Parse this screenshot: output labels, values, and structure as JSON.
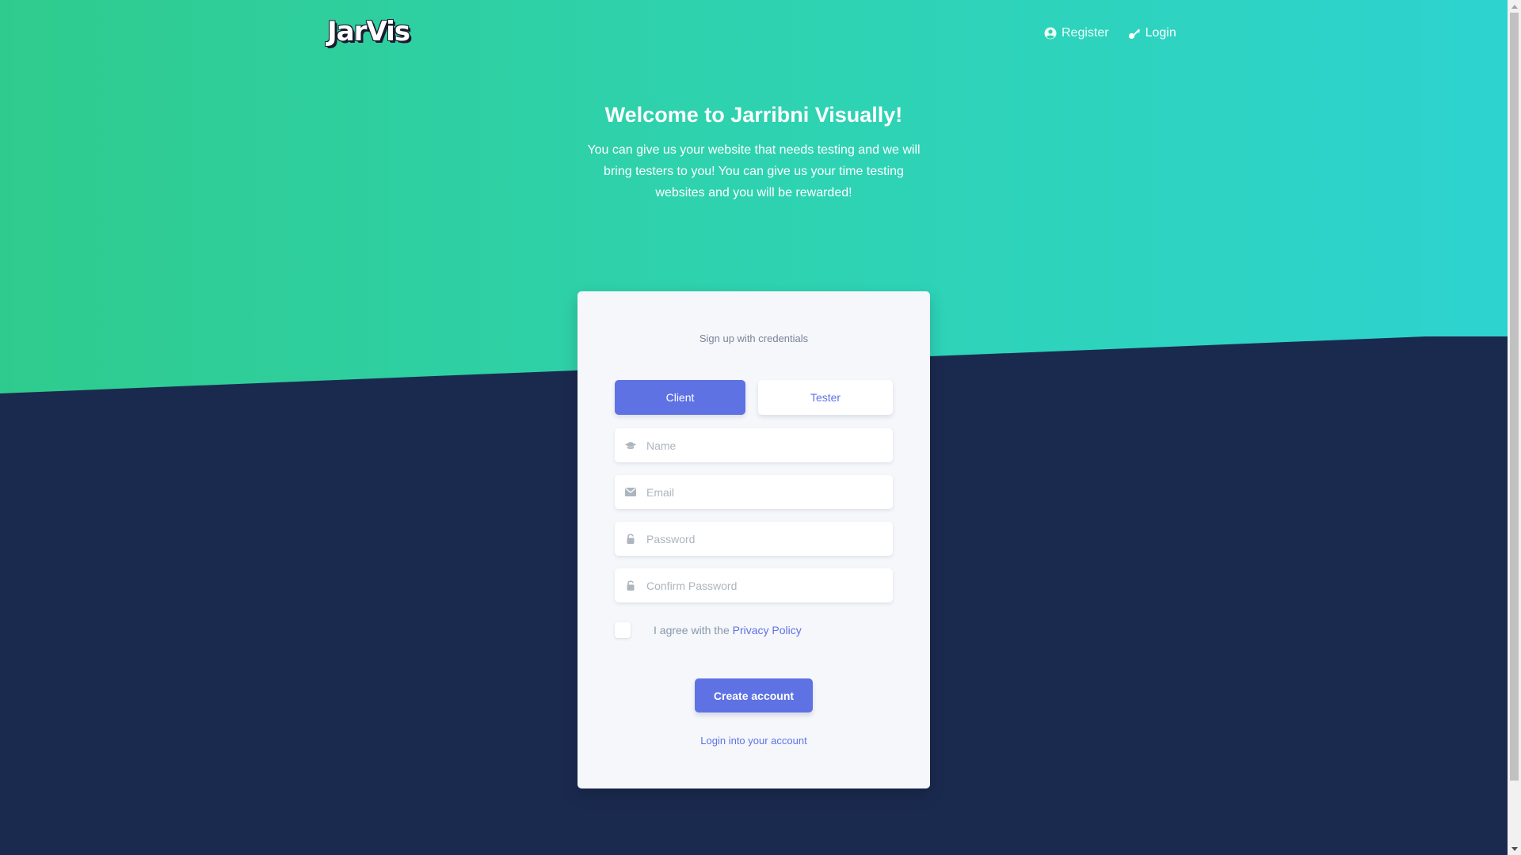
{
  "navbar": {
    "logo": "JarVis",
    "links": [
      {
        "label": "Register",
        "icon": "user-circle-icon"
      },
      {
        "label": "Login",
        "icon": "key-icon"
      }
    ]
  },
  "hero": {
    "title": "Welcome to Jarribni Visually!",
    "subtitle": "You can give us your website that needs testing and we will bring testers to you! You can give us your time testing websites and you will be rewarded!"
  },
  "card": {
    "heading": "Sign up with credentials",
    "roles": {
      "client": "Client",
      "tester": "Tester",
      "selected": "Client"
    },
    "fields": {
      "name": {
        "placeholder": "Name",
        "value": "",
        "icon": "graduation-cap-icon"
      },
      "email": {
        "placeholder": "Email",
        "value": "",
        "icon": "envelope-icon"
      },
      "password": {
        "placeholder": "Password",
        "value": "",
        "icon": "lock-icon"
      },
      "confirm": {
        "placeholder": "Confirm Password",
        "value": "",
        "icon": "lock-icon"
      }
    },
    "agree": {
      "text": "I agree with the ",
      "link": "Privacy Policy",
      "checked": false
    },
    "submit": "Create account",
    "login_link": "Login into your account"
  },
  "colors": {
    "gradient_start": "#2fcb8e",
    "gradient_end": "#2dd3cf",
    "background": "#1a2a4f",
    "primary": "#5e72e4"
  }
}
